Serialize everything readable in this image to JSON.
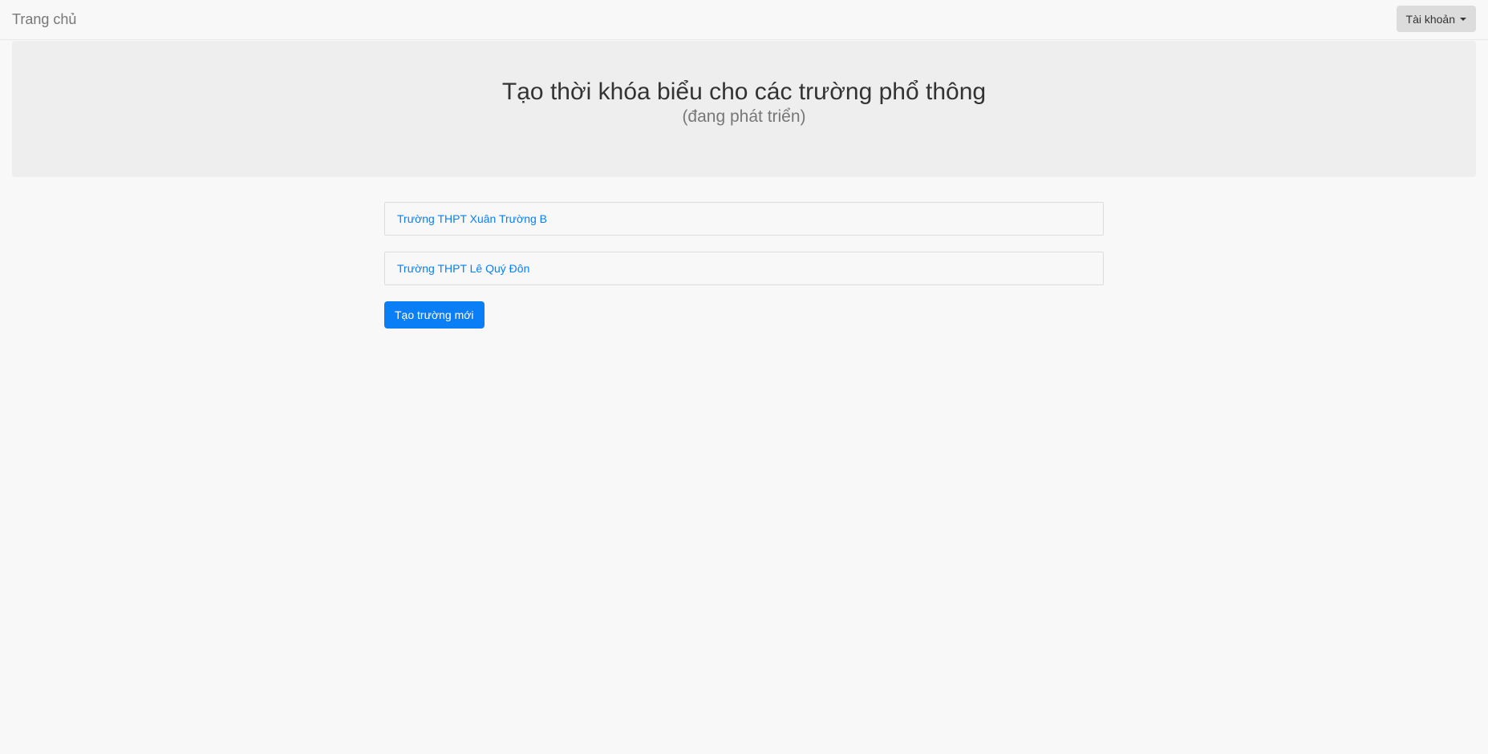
{
  "navbar": {
    "brand": "Trang chủ",
    "account_label": "Tài khoản"
  },
  "hero": {
    "title": "Tạo thời khóa biểu cho các trường phổ thông",
    "subtitle": "(đang phát triển)"
  },
  "schools": [
    {
      "name": "Trường THPT Xuân Trường B"
    },
    {
      "name": "Trường THPT Lê Quý Đôn"
    }
  ],
  "actions": {
    "create_school_label": "Tạo trường mới"
  },
  "colors": {
    "link": "#0a7ff5",
    "primary_button": "#0a7ff5",
    "jumbotron_bg": "#eeeeee",
    "page_bg": "#f8f8f8"
  }
}
